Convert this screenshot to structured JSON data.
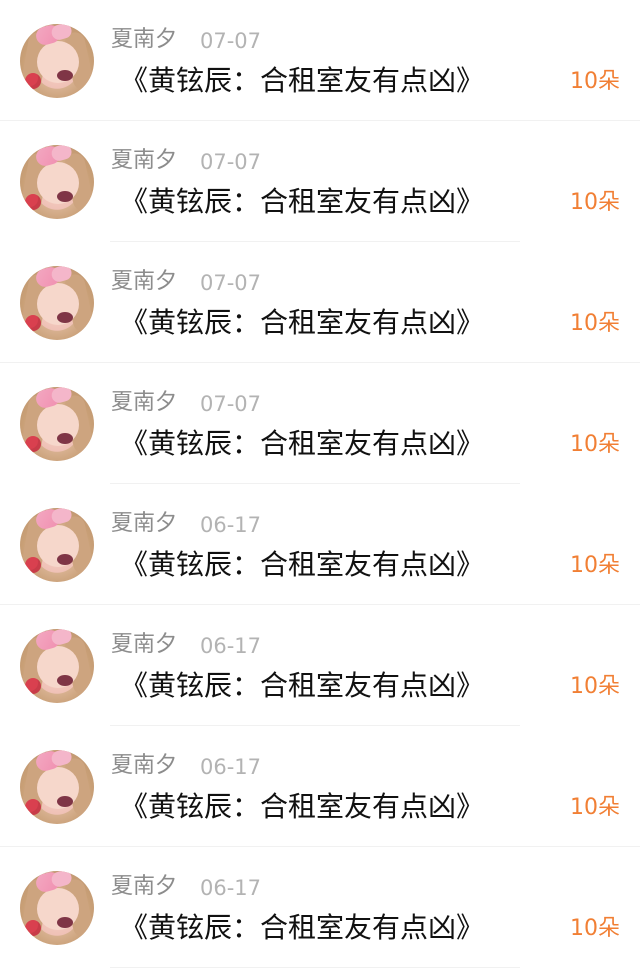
{
  "items": [
    {
      "name": "夏南夕",
      "date": "07-07",
      "title": "《黄铉辰：合租室友有点凶》",
      "amount": "10朵"
    },
    {
      "name": "夏南夕",
      "date": "07-07",
      "title": "《黄铉辰：合租室友有点凶》",
      "amount": "10朵"
    },
    {
      "name": "夏南夕",
      "date": "07-07",
      "title": "《黄铉辰：合租室友有点凶》",
      "amount": "10朵"
    },
    {
      "name": "夏南夕",
      "date": "07-07",
      "title": "《黄铉辰：合租室友有点凶》",
      "amount": "10朵"
    },
    {
      "name": "夏南夕",
      "date": "06-17",
      "title": "《黄铉辰：合租室友有点凶》",
      "amount": "10朵"
    },
    {
      "name": "夏南夕",
      "date": "06-17",
      "title": "《黄铉辰：合租室友有点凶》",
      "amount": "10朵"
    },
    {
      "name": "夏南夕",
      "date": "06-17",
      "title": "《黄铉辰：合租室友有点凶》",
      "amount": "10朵"
    },
    {
      "name": "夏南夕",
      "date": "06-17",
      "title": "《黄铉辰：合租室友有点凶》",
      "amount": "10朵"
    }
  ],
  "colors": {
    "name": "#8c8c8c",
    "date": "#b3b3b3",
    "title": "#111111",
    "amount": "#f17f34",
    "divider": "#f1f1f1"
  }
}
